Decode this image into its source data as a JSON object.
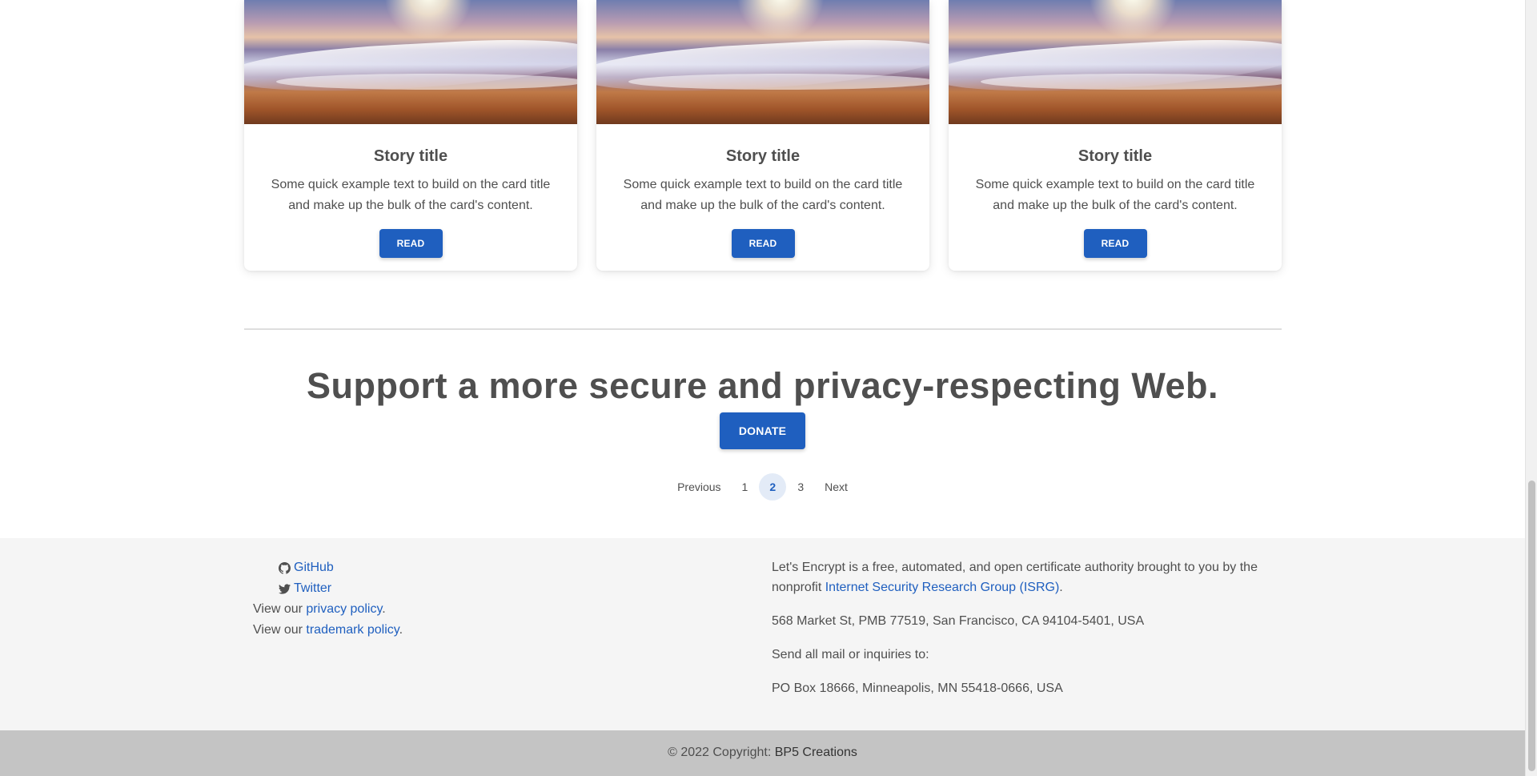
{
  "cards": [
    {
      "title": "Story title",
      "text": "Some quick example text to build on the card title and make up the bulk of the card's content.",
      "button": "Read"
    },
    {
      "title": "Story title",
      "text": "Some quick example text to build on the card title and make up the bulk of the card's content.",
      "button": "Read"
    },
    {
      "title": "Story title",
      "text": "Some quick example text to build on the card title and make up the bulk of the card's content.",
      "button": "Read"
    }
  ],
  "support": {
    "title": "Support a more secure and privacy-respecting Web.",
    "donate": "Donate"
  },
  "pagination": {
    "previous": "Previous",
    "pages": [
      "1",
      "2",
      "3"
    ],
    "active": "2",
    "next": "Next"
  },
  "footer": {
    "links": {
      "github": "GitHub",
      "twitter": "Twitter",
      "view_our_1": "View our ",
      "privacy": "privacy policy",
      "view_our_2": "View our ",
      "trademark": "trademark policy",
      "period": "."
    },
    "about_text": "Let's Encrypt is a free, automated, and open certificate authority brought to you by the nonprofit ",
    "isrg_link": "Internet Security Research Group (ISRG)",
    "about_period": ".",
    "address": "568 Market St, PMB 77519, San Francisco, CA 94104-5401, USA",
    "mail_label": "Send all mail or inquiries to:",
    "po_box": "PO Box 18666, Minneapolis, MN 55418-0666, USA"
  },
  "copyright": {
    "text": "© 2022 Copyright: ",
    "brand": "BP5 Creations"
  },
  "colors": {
    "primary": "#1f5fbf",
    "text": "#4f4f4f",
    "footer_bg": "#f5f5f5",
    "copyright_bg": "#c4c4c4"
  }
}
